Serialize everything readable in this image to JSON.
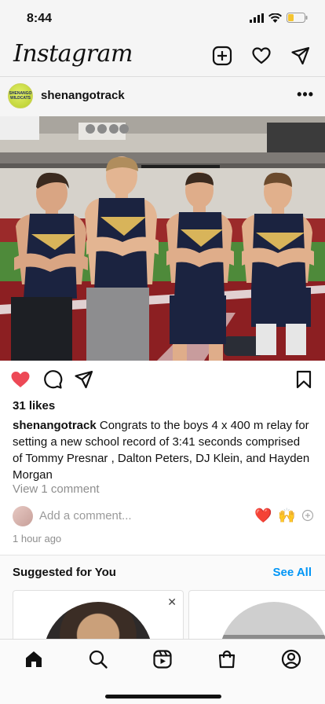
{
  "status_bar": {
    "time": "8:44",
    "battery_color": "#f4c430"
  },
  "header": {
    "logo": "Instagram",
    "icons": [
      "new-post-icon",
      "heart-icon",
      "direct-message-icon"
    ]
  },
  "post": {
    "avatar_text": "SHENANGO WILDCATS",
    "username": "shenangotrack",
    "more_label": "•••",
    "image_description_icon": "photo",
    "liked": true,
    "like_color": "#ed4956",
    "likes": "31 likes",
    "caption_user": "shenangotrack",
    "caption_text": "Congrats to the boys 4 x 400 m relay for setting a new school record of 3:41 seconds comprised of Tommy Presnar , Dalton Peters, DJ Klein, and Hayden Morgan",
    "view_comments": "View 1 comment",
    "add_comment_placeholder": "Add a comment...",
    "quick_emojis": [
      "❤️",
      "🙌"
    ],
    "timestamp": "1 hour ago"
  },
  "suggested": {
    "title": "Suggested for You",
    "see_all": "See All",
    "see_all_color": "#0095f6",
    "close_label": "✕"
  },
  "tab_bar": {
    "tabs": [
      "home-icon",
      "search-icon",
      "reels-icon",
      "shop-icon",
      "profile-icon"
    ]
  }
}
